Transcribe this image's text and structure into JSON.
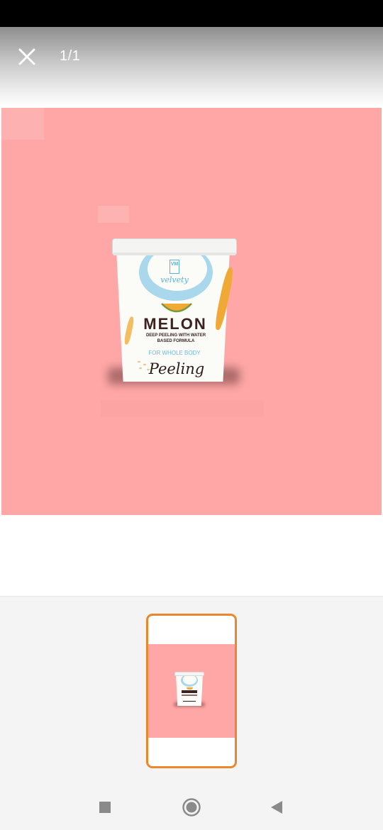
{
  "viewer": {
    "page_counter": "1/1",
    "close_icon": "close-icon"
  },
  "product": {
    "brand": "velvety",
    "logo_text": "VM",
    "name": "MELON",
    "description_line1": "DEEP PEELING WITH WATER",
    "description_line2": "BASED FORMULA",
    "tagline": "FOR WHOLE BODY",
    "script_label": "Peeling"
  },
  "thumbnails": {
    "selected_index": 1,
    "count": 1
  },
  "nav": {
    "recents_icon": "square-icon",
    "home_icon": "circle-icon",
    "back_icon": "triangle-back-icon"
  },
  "colors": {
    "background_pink": "#fea7a6",
    "selection_orange": "#e8872e",
    "brand_blue": "#5fb0d8",
    "melon_orange": "#f0a935"
  }
}
